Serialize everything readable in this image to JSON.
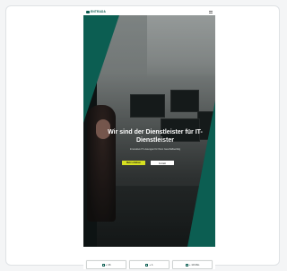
{
  "header": {
    "logo_text": "ENTRADA",
    "menu_icon": "hamburger-menu-icon"
  },
  "hero": {
    "headline": "Wir sind der Dienstleister für IT-Dienstleister",
    "subline": "Innovative IT-Lösungen für Ihren Geschäftserfolg",
    "primary_button": "Mehr erfahren",
    "secondary_button": "Kontakt"
  },
  "tiles": [
    {
      "label": "+ 16",
      "icon": "tile-icon"
    },
    {
      "label": "+ 1",
      "icon": "tile-icon"
    },
    {
      "label": "+ 10 Mio",
      "icon": "tile-icon"
    }
  ],
  "colors": {
    "brand_teal": "#0c5e52",
    "accent_lime": "#d6e021",
    "background": "#f4f5f6"
  }
}
